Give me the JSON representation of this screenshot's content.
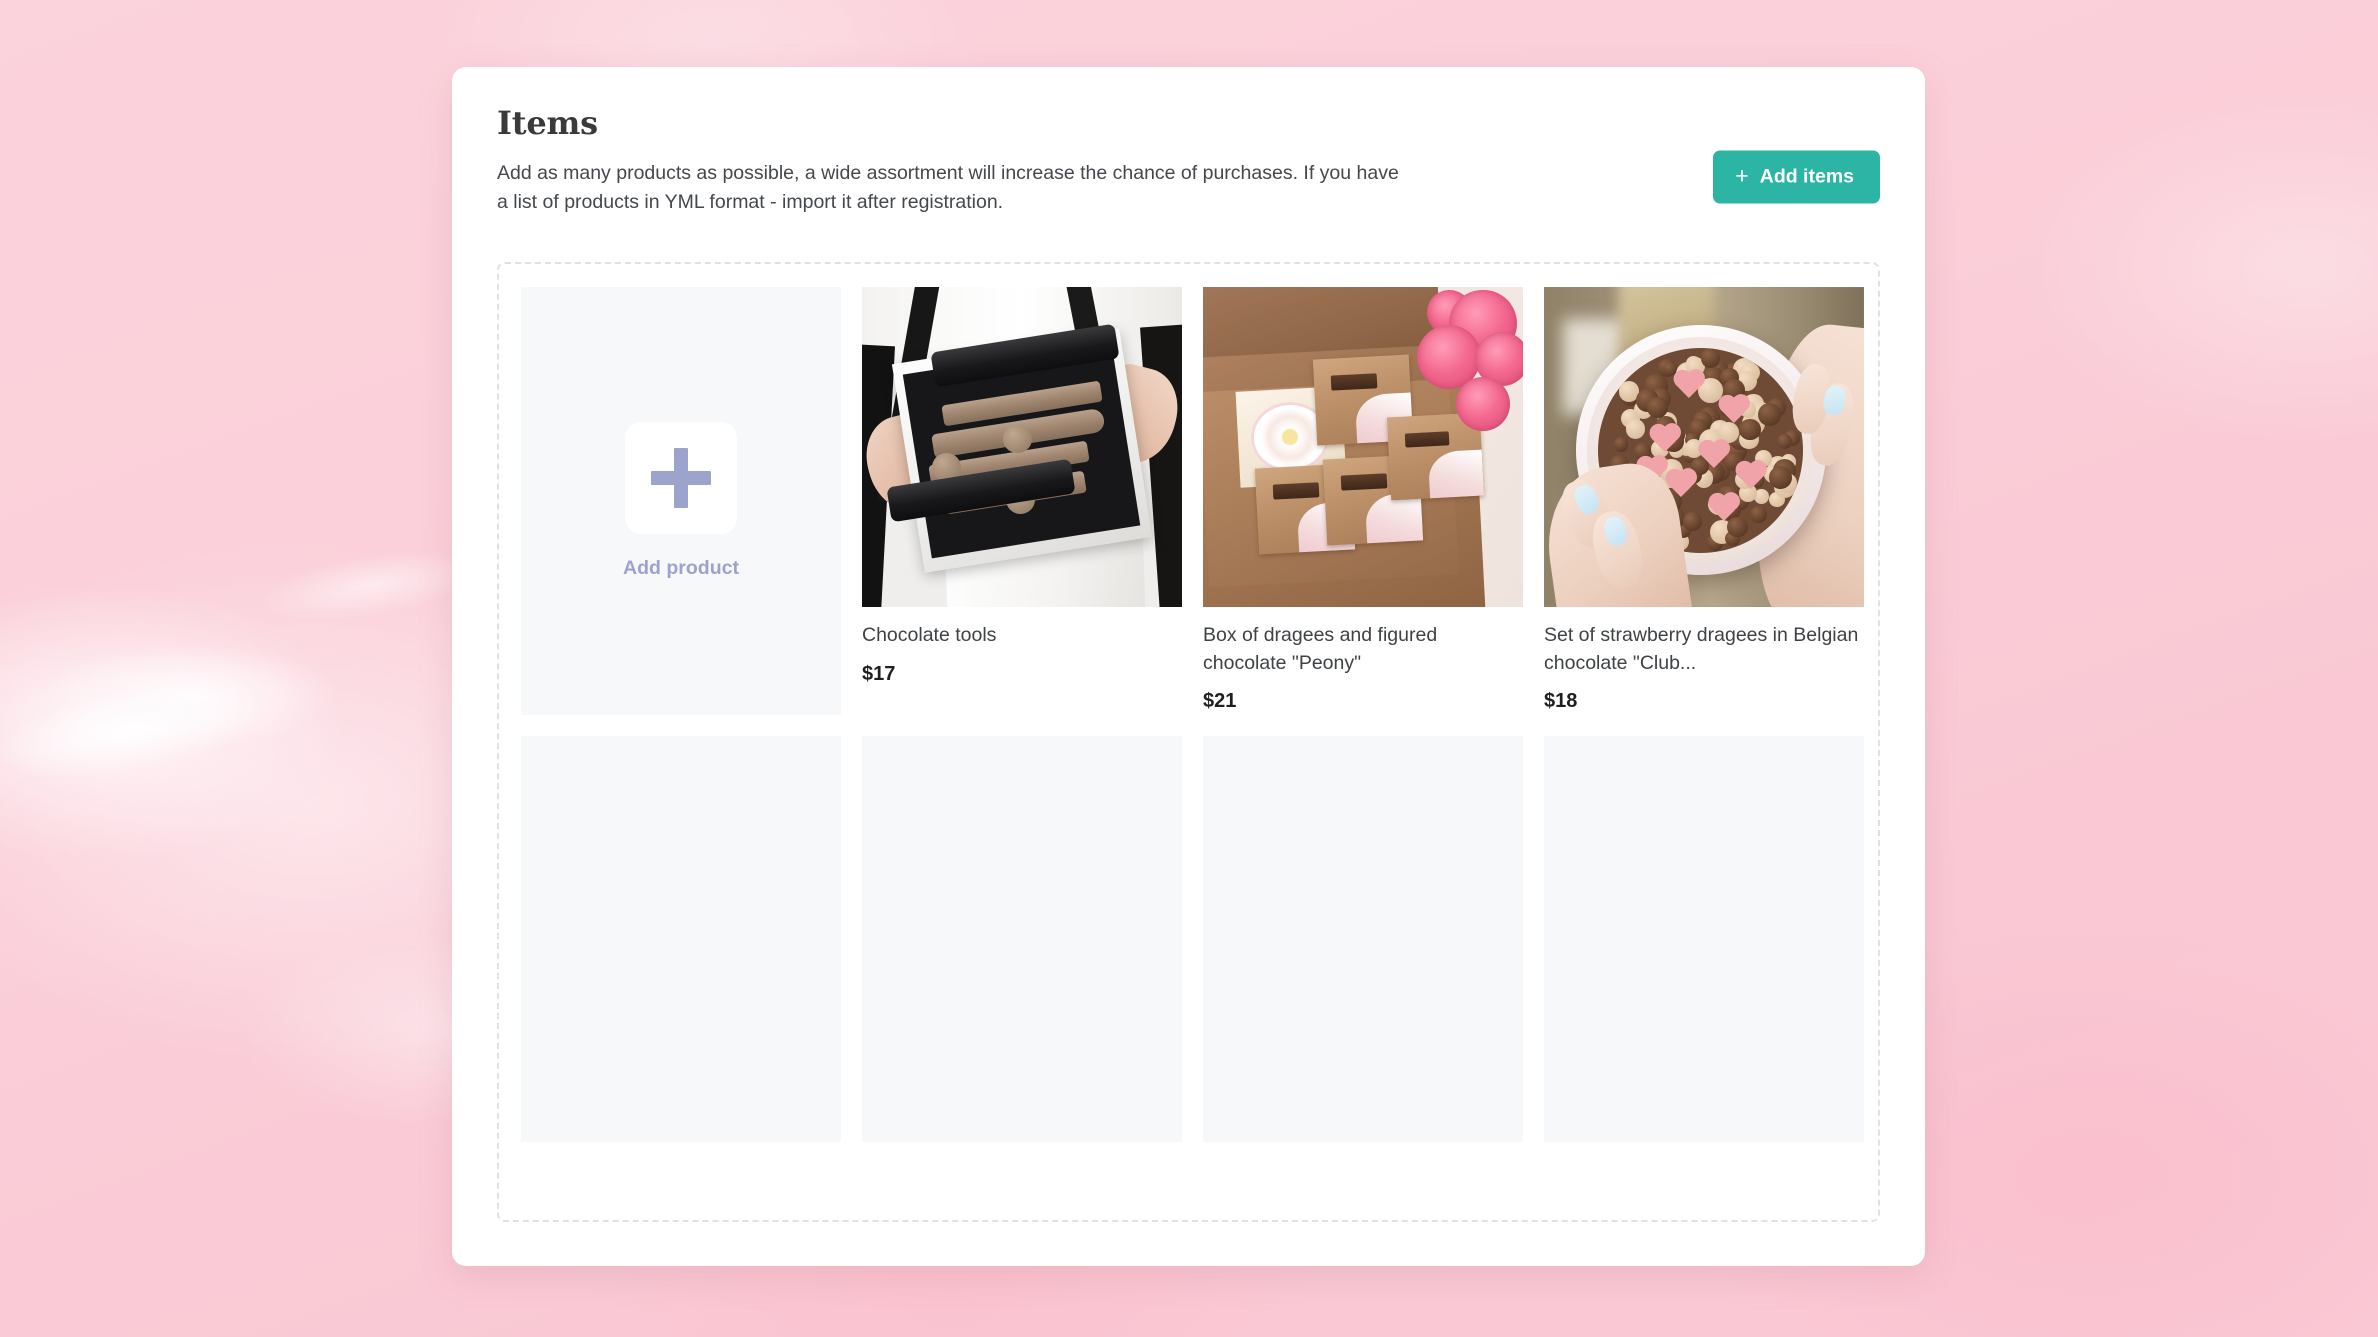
{
  "header": {
    "title": "Items",
    "subtitle": "Add as many products as possible, a wide assortment will increase the chance of purchases. If you have a list of products in YML format - import it after registration.",
    "add_items_label": "Add items",
    "add_items_icon": "plus-icon",
    "accent_color": "#2cb5a4"
  },
  "dropzone": {
    "add_product": {
      "label": "Add product",
      "icon": "plus-icon",
      "icon_color": "#9ca3cd"
    },
    "products": [
      {
        "title": "Chocolate tools",
        "price": "$17",
        "image_alt": "person holding a black box of chocolate tools"
      },
      {
        "title": "Box of dragees and figured chocolate \"Peony\"",
        "price": "$21",
        "image_alt": "kraft gift box with chocolate packets and pink roses"
      },
      {
        "title": "Set of strawberry dragees in Belgian chocolate \"Club...",
        "price": "$18",
        "image_alt": "hands holding a round box of pink hearts and chocolate dragees"
      }
    ],
    "empty_slots": 4
  },
  "colors": {
    "page_background": "#fad0d9",
    "panel_background": "#ffffff",
    "tile_background": "#f7f8fa",
    "dashed_border": "#dfe1e4"
  }
}
